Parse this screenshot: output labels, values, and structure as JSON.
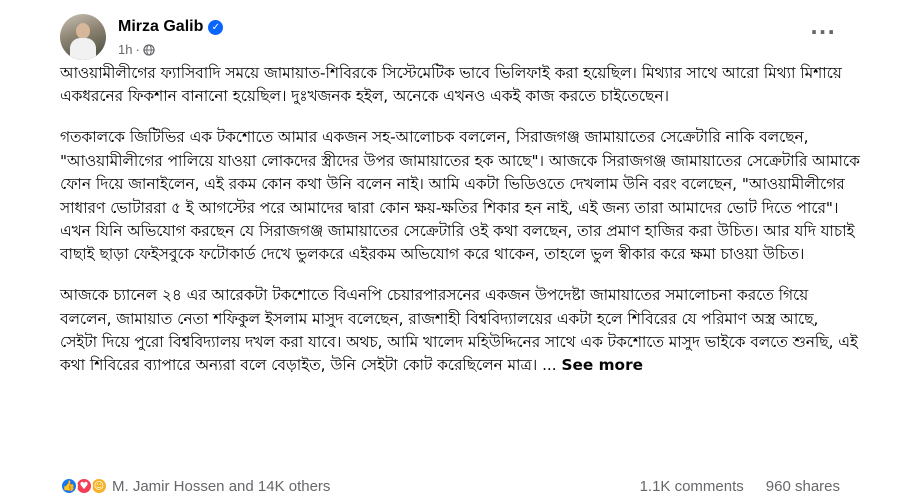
{
  "post": {
    "author": "Mirza Galib",
    "time": "1h",
    "visibility_icon": "globe-icon",
    "more_label": "···",
    "paragraphs": [
      "আওয়ামীলীগের ফ্যাসিবাদি সময়ে জামায়াত-শিবিরকে সিস্টেমেটিক ভাবে ভিলিফাই করা হয়েছিল। মিথ্যার সাথে আরো মিথ্যা মিশায়ে একধরনের ফিকশান বানানো হয়েছিল। দুঃখজনক হইল, অনেকে এখনও একই কাজ করতে চাইতেছেন।",
      "গতকালকে জিটিভির এক টকশোতে আমার একজন সহ-আলোচক বললেন, সিরাজগঞ্জ জামায়াতের সেক্রেটারি নাকি বলছেন, \"আওয়ামীলীগের পালিয়ে যাওয়া লোকদের স্ত্রীদের উপর জামায়াতের হক আছে\"। আজকে সিরাজগঞ্জ জামায়াতের সেক্রেটারি আমাকে ফোন দিয়ে জানাইলেন, এই রকম কোন কথা উনি বলেন নাই। আমি একটা ভিডিওতে দেখলাম উনি বরং বলেছেন, \"আওয়ামীলীগের সাধারণ ভোটাররা ৫ ই আগস্টের পরে আমাদের দ্বারা কোন ক্ষয়-ক্ষতির শিকার হন নাই, এই জন্য তারা আমাদের ভোট দিতে পারে\"। এখন যিনি অভিযোগ করছেন যে সিরাজগঞ্জ জামায়াতের সেক্রেটারি ওই কথা বলছেন, তার প্রমাণ হাজির করা উচিত। আর যদি যাচাই বাছাই ছাড়া ফেইসবুকে ফটোকার্ড দেখে ভুলকরে এইরকম অভিযোগ করে থাকেন, তাহলে ভুল স্বীকার করে ক্ষমা চাওয়া উচিত।",
      "আজকে চ্যানেল ২৪ এর আরেকটা টকশোতে বিএনপি চেয়ারপারসনের একজন উপদেষ্টা জামায়াতের সমালোচনা করতে গিয়ে বললেন, জামায়াত নেতা শফিকুল ইসলাম মাসুদ বলেছেন, রাজশাহী বিশ্ববিদ্যালয়ের একটা হলে শিবিরের যে পরিমাণ অস্ত্র আছে, সেইটা দিয়ে পুরো বিশ্ববিদ্যালয় দখল করা যাবে। অথচ, আমি খালেদ মহিউদ্দিনের সাথে এক টকশোতে মাসুদ ভাইকে বলতে শুনছি, এই কথা শিবিরের ব্যাপারে অন্যরা বলে বেড়াইত, উনি সেইটা কোট করেছিলেন মাত্র।"
    ],
    "ellipsis": "...",
    "see_more": "See more"
  },
  "footer": {
    "reaction_icons": [
      "like-icon",
      "love-icon",
      "haha-icon"
    ],
    "reactions_text": "M. Jamir Hossen and 14K others",
    "comments": "1.1K comments",
    "shares": "960 shares"
  },
  "colors": {
    "accent": "#0866ff",
    "secondary_text": "#65676b",
    "like": "#1877f2",
    "love": "#f33e58",
    "haha": "#f7b125"
  }
}
